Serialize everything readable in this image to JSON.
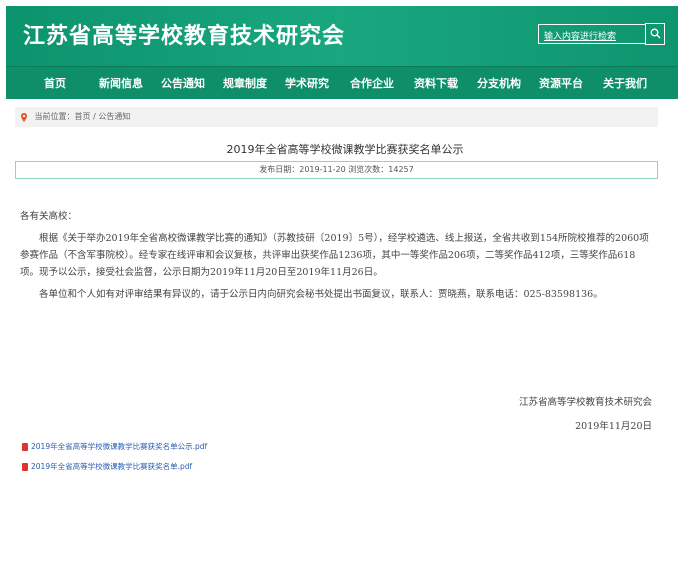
{
  "header": {
    "site_title": "江苏省高等学校教育技术研究会",
    "search_placeholder": "输入内容进行检索"
  },
  "nav": {
    "items": [
      "首页",
      "新闻信息",
      "公告通知",
      "规章制度",
      "学术研究",
      "合作企业",
      "资料下载",
      "分支机构",
      "资源平台",
      "关于我们"
    ]
  },
  "breadcrumb": {
    "text": "当前位置：首页 / 公告通知"
  },
  "article": {
    "title": "2019年全省高等学校微课教学比赛获奖名单公示",
    "meta": "发布日期：2019-11-20 浏览次数：14257",
    "salutation": "各有关高校：",
    "para1": "根据《关于举办2019年全省高校微课教学比赛的通知》（苏教技研〔2019〕5号），经学校遴选、线上报送，全省共收到154所院校推荐的2060项参赛作品（不含军事院校）。经专家在线评审和会议复核，共评审出获奖作品1236项，其中一等奖作品206项，二等奖作品412项，三等奖作品618项。现予以公示，接受社会监督，公示日期为2019年11月20日至2019年11月26日。",
    "para2": "各单位和个人如有对评审结果有异议的，请于公示日内向研究会秘书处提出书面复议，联系人：贾晓燕，联系电话：025-83598136。",
    "signature": "江苏省高等学校教育技术研究会",
    "date": "2019年11月20日"
  },
  "attachments": [
    {
      "label": "2019年全省高等学校微课教学比赛获奖名单公示.pdf"
    },
    {
      "label": "2019年全省高等学校微课教学比赛获奖名单.pdf"
    }
  ],
  "colors": {
    "brand_green": "#0f9a72",
    "link_blue": "#2a5db0"
  }
}
